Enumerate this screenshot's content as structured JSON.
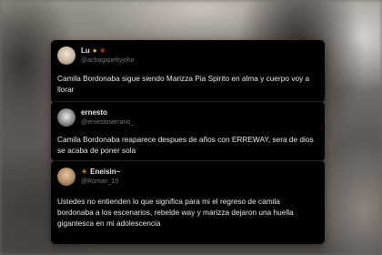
{
  "tweets": [
    {
      "display_name": "Lu",
      "name_emojis": [
        "sun-emoji",
        "heart-emoji"
      ],
      "handle": "@achagapettyjohn",
      "text": "Camila Bordonaba sigue siendo Marizza Pia Spirito en alma y cuerpo voy a llorar"
    },
    {
      "display_name": "ernesto",
      "handle": "@ernestoserrano_",
      "text": "Camila Bordonaba reaparece despues de años con ERREWAY, sera de dios se acaba de poner sola"
    },
    {
      "display_name": "Eneisin~",
      "name_prefix_emoji": "sun-emoji",
      "handle": "@Roman_15",
      "text": "Ustedes no entienden lo que significa para mi el regreso de camila bordonaba a los escenarios, rebelde way y marizza dejaron una huella gigantesca en mi adolescencia"
    }
  ],
  "colors": {
    "card_background": "#000000",
    "text_primary": "#e7e9ea",
    "text_secondary": "#71767b"
  }
}
